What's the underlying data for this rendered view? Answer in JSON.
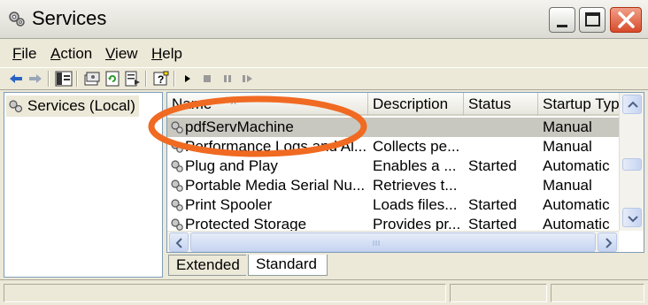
{
  "window": {
    "title": "Services",
    "title_icon": "gears-icon"
  },
  "menu": {
    "items": [
      {
        "hotkey": "F",
        "rest": "ile"
      },
      {
        "hotkey": "A",
        "rest": "ction"
      },
      {
        "hotkey": "V",
        "rest": "iew"
      },
      {
        "hotkey": "H",
        "rest": "elp"
      }
    ]
  },
  "toolbar": {
    "icons": [
      "back-arrow-icon",
      "forward-arrow-icon",
      "show-hide-console-tree-icon",
      "properties-icon",
      "refresh-icon",
      "export-list-icon",
      "help-icon",
      "start-service-icon",
      "stop-service-icon",
      "pause-service-icon",
      "restart-service-icon"
    ]
  },
  "tree": {
    "root_label": "Services (Local)"
  },
  "table": {
    "columns": [
      "Name",
      "Description",
      "Status",
      "Startup Typ"
    ],
    "sort_indicator": "^",
    "rows": [
      {
        "name": "pdfServMachine",
        "description": "",
        "status": "",
        "startup": "Manual",
        "selected": true
      },
      {
        "name": "Performance Logs and Al...",
        "description": "Collects pe...",
        "status": "",
        "startup": "Manual"
      },
      {
        "name": "Plug and Play",
        "description": "Enables a ...",
        "status": "Started",
        "startup": "Automatic"
      },
      {
        "name": "Portable Media Serial Nu...",
        "description": "Retrieves t...",
        "status": "",
        "startup": "Manual"
      },
      {
        "name": "Print Spooler",
        "description": "Loads files...",
        "status": "Started",
        "startup": "Automatic"
      },
      {
        "name": "Protected Storage",
        "description": "Provides pr...",
        "status": "Started",
        "startup": "Automatic"
      }
    ]
  },
  "tabs": {
    "extended": "Extended",
    "standard": "Standard",
    "active": "Standard"
  },
  "colors": {
    "annotation": "#f06a22",
    "selected_row": "#c9c8c0",
    "close_button": "#d74a2a"
  }
}
